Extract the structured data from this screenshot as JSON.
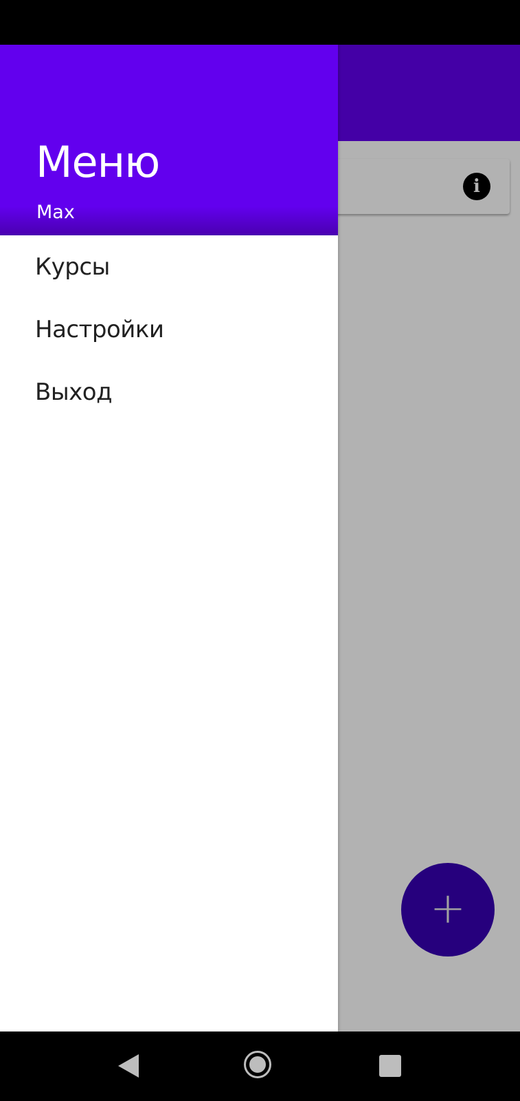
{
  "colors": {
    "primary": "#6200ee",
    "primary_dark": "#3700b3",
    "drawer_background": "#ffffff",
    "scrim": "rgba(0,0,0,0.3)"
  },
  "drawer": {
    "title": "Меню",
    "subtitle": "Max",
    "items": [
      {
        "label": "Курсы"
      },
      {
        "label": "Настройки"
      },
      {
        "label": "Выход"
      }
    ]
  },
  "app": {
    "card_icon": "info-icon",
    "fab_icon": "plus-icon"
  },
  "system_nav": {
    "icons": [
      "back-icon",
      "home-icon",
      "recents-icon"
    ]
  }
}
